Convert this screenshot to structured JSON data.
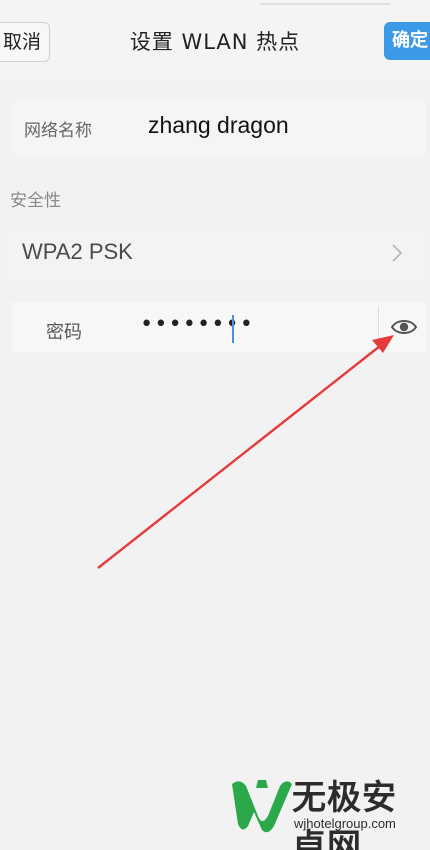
{
  "header": {
    "cancel_label": "取消",
    "title": "设置 WLAN 热点",
    "confirm_label": "确定"
  },
  "form": {
    "network_name_label": "网络名称",
    "network_name_value": "zhang dragon",
    "security_section_title": "安全性",
    "security_value": "WPA2 PSK",
    "password_label": "密码",
    "password_value": "••••••••"
  },
  "icons": {
    "chevron": "chevron-right-icon",
    "eye": "eye-icon"
  },
  "colors": {
    "accent": "#3a9ae8",
    "annotation": "#e63b3b",
    "watermark_green": "#2aa84a"
  },
  "watermark": {
    "title": "无极安卓网",
    "url": "wjhotelgroup.com"
  }
}
